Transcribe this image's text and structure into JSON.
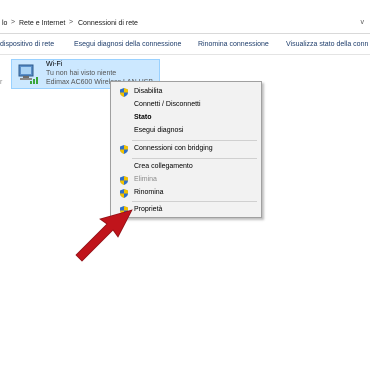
{
  "breadcrumb": {
    "items": [
      "lo",
      "Rete e Internet",
      "Connessioni di rete"
    ],
    "separator": ">",
    "dropdown": "v"
  },
  "command_bar": {
    "items": [
      "dispositivo di rete",
      "Esegui diagnosi della connessione",
      "Rinomina connessione",
      "Visualizza stato della conn"
    ]
  },
  "adapter": {
    "name": "Wi-Fi",
    "status": "Tu non hai visto niente",
    "device": "Edimax AC600 Wireless LAN USB",
    "icon": "wifi-adapter-icon"
  },
  "side_text": "r",
  "context_menu": {
    "items": [
      {
        "label": "Disabilita",
        "shield": true,
        "bold": false,
        "disabled": false
      },
      {
        "label": "Connetti / Disconnetti",
        "shield": false,
        "bold": false,
        "disabled": false
      },
      {
        "label": "Stato",
        "shield": false,
        "bold": true,
        "disabled": false
      },
      {
        "label": "Esegui diagnosi",
        "shield": false,
        "bold": false,
        "disabled": false
      },
      {
        "label": "Connessioni con bridging",
        "shield": true,
        "bold": false,
        "disabled": false
      },
      {
        "label": "Crea collegamento",
        "shield": false,
        "bold": false,
        "disabled": false
      },
      {
        "label": "Elimina",
        "shield": true,
        "bold": false,
        "disabled": true
      },
      {
        "label": "Rinomina",
        "shield": true,
        "bold": false,
        "disabled": false
      },
      {
        "label": "Proprietà",
        "shield": true,
        "bold": false,
        "disabled": false
      }
    ]
  },
  "colors": {
    "selection": "#cce8ff",
    "arrow": "#c0141b",
    "menu_background": "#f2f2f2"
  }
}
